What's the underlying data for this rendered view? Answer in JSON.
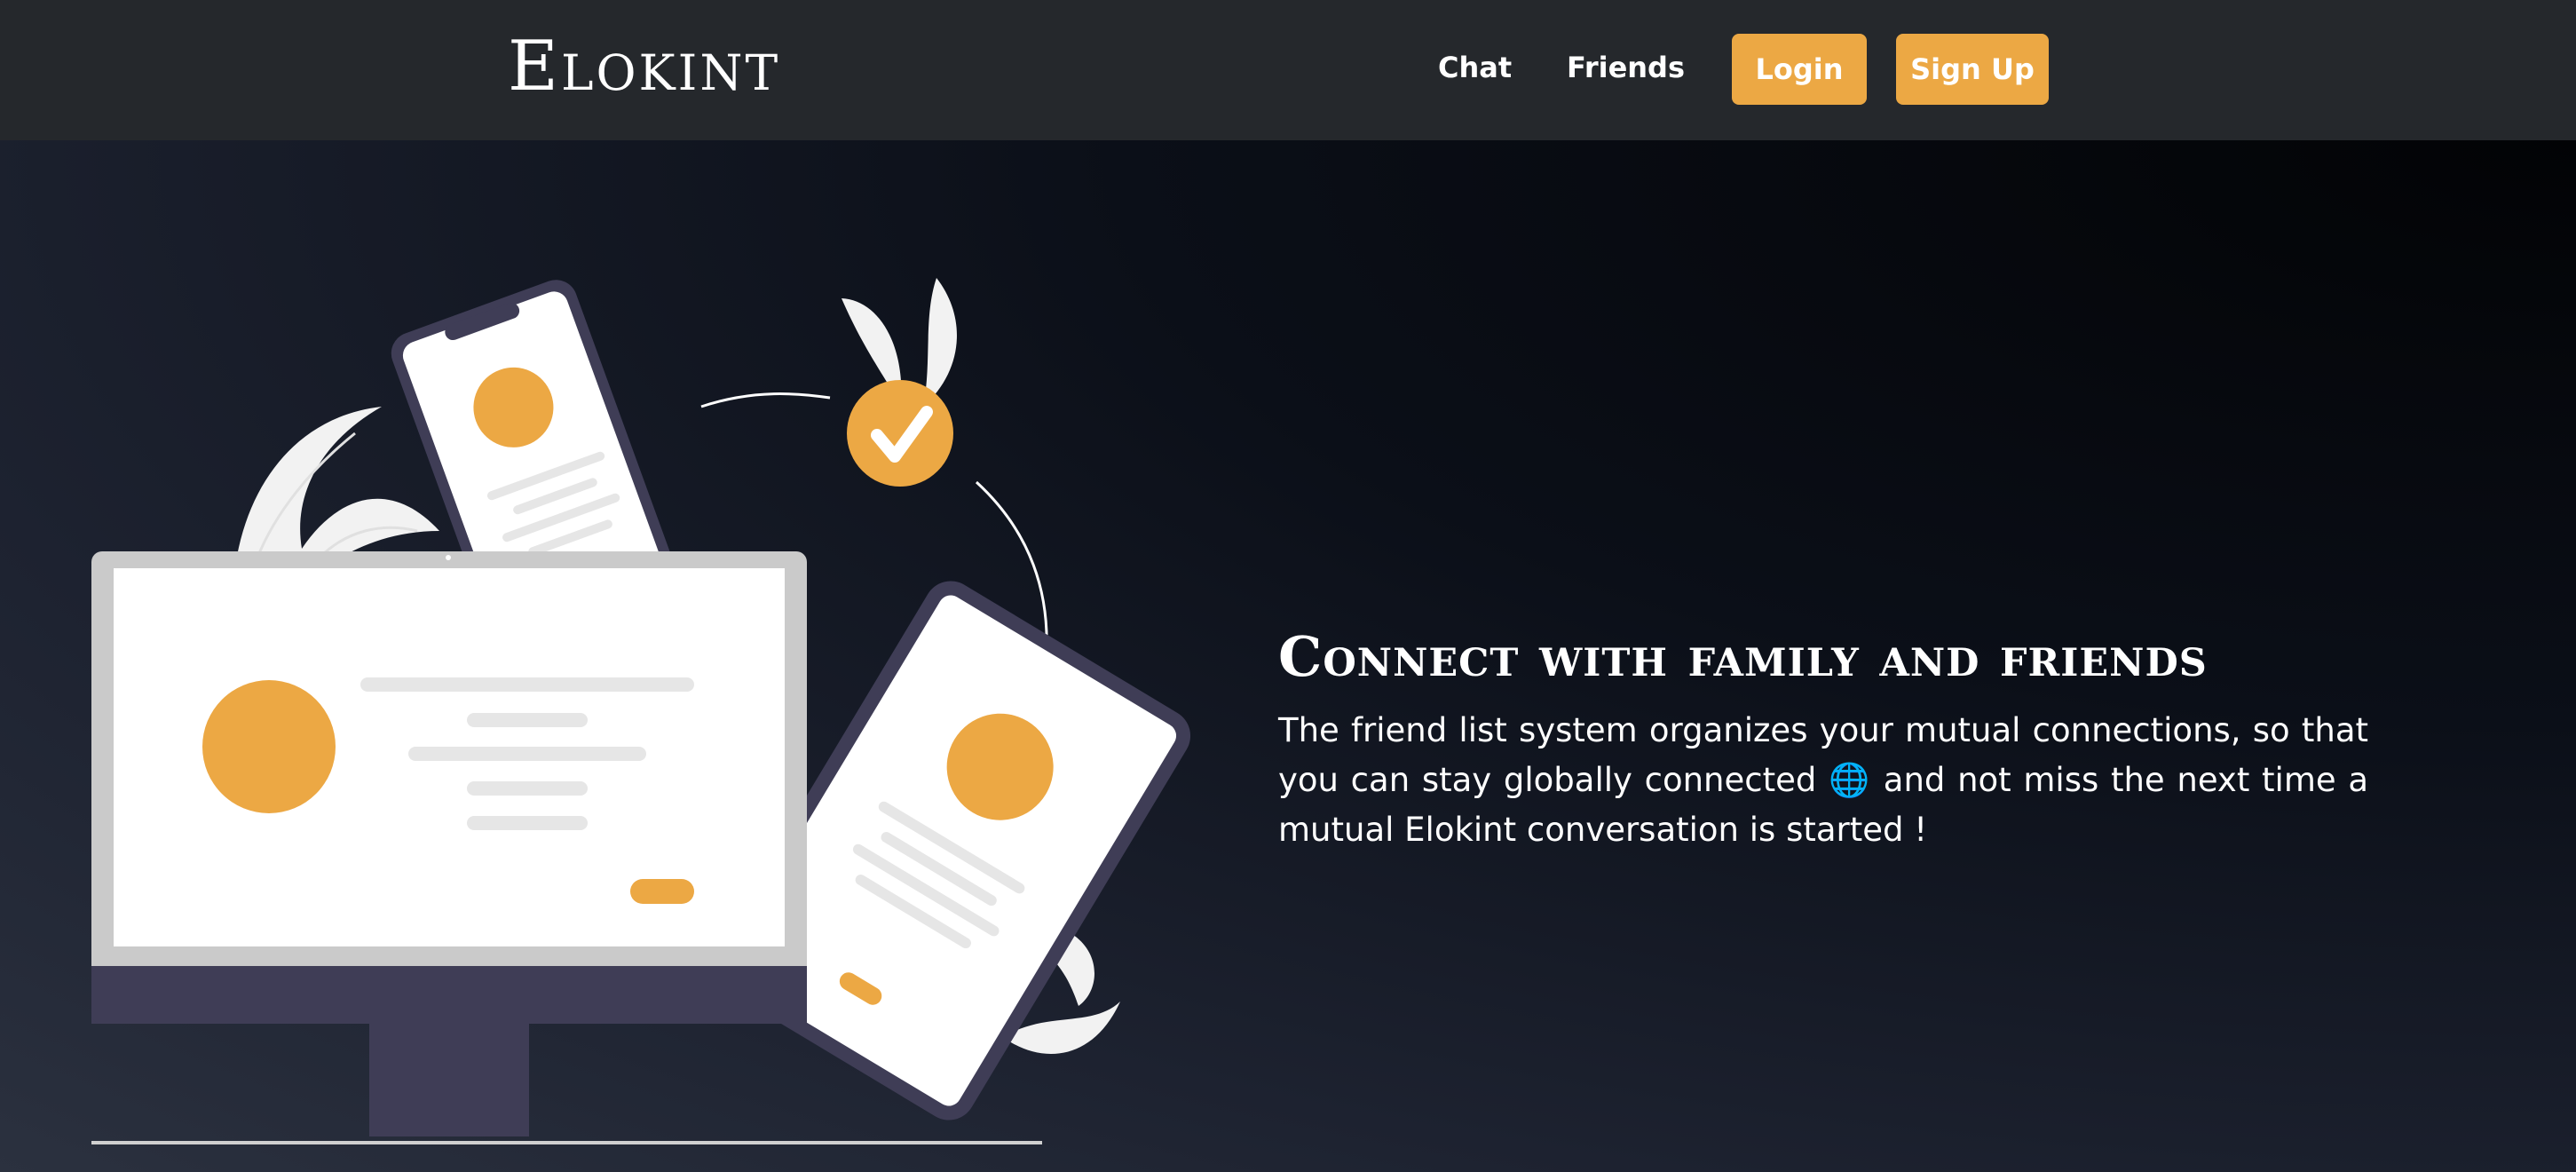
{
  "nav": {
    "brand": "Elokint",
    "links": [
      {
        "label": "Chat"
      },
      {
        "label": "Friends"
      }
    ],
    "login_label": "Login",
    "signup_label": "Sign Up"
  },
  "hero": {
    "title": "Connect with family and friends",
    "text": "The friend list system organizes your mutual connections, so that you can stay globally connected 🌐 and not miss the next time a mutual Elokint conversation is started !"
  },
  "colors": {
    "accent": "#eca844",
    "navbar_bg": "#25282c",
    "hero_bg_dark": "#020305",
    "hero_bg_light": "#2b313f",
    "device_frame": "#3f3d56",
    "monitor_bezel": "#cacaca",
    "screen": "#ffffff",
    "placeholder_line": "#e6e6e6",
    "leaf": "#f2f2f2"
  },
  "icons": {
    "check": "check-icon",
    "globe": "globe-icon"
  }
}
